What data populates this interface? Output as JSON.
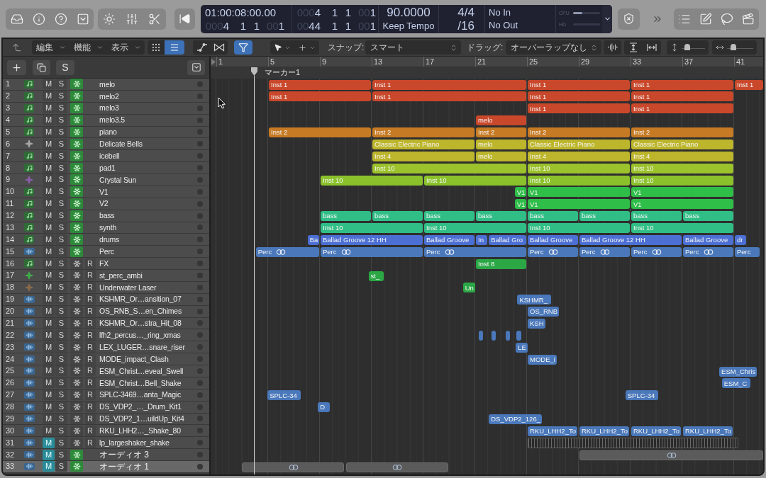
{
  "control_bar": {
    "lcd": {
      "smpte": "01:00:08:00.00",
      "position": [
        {
          "lead": "000",
          "digits": "4"
        },
        {
          "digits": "1"
        },
        {
          "digits": "1"
        },
        {
          "lead": "00",
          "digits": "1"
        }
      ],
      "left_locator": [
        {
          "lead": "000",
          "digits": "4"
        },
        {
          "digits": "1"
        },
        {
          "digits": "1"
        },
        {
          "lead": "00",
          "digits": "1"
        }
      ],
      "right_locator": [
        {
          "lead": "00",
          "digits": "44"
        },
        {
          "digits": "1"
        },
        {
          "digits": "1"
        },
        {
          "lead": "00",
          "digits": "1"
        }
      ],
      "tempo": "90.0000",
      "tempo_mode": "Keep Tempo",
      "time_signature": "4/4",
      "division": "/16",
      "midi_in": "No In",
      "midi_out": "No Out",
      "meters": [
        {
          "label": "CPU",
          "level": 0.35
        },
        {
          "label": "HD"
        }
      ]
    }
  },
  "arrange_toolbar": {
    "menus": [
      "編集",
      "機能",
      "表示"
    ],
    "view_toggles": [
      {
        "on": false
      },
      {
        "on": true
      },
      {
        "on": false
      },
      {
        "on": false
      },
      {
        "on": true
      }
    ],
    "snap_label": "スナップ:",
    "snap_value": "スマート",
    "drag_label": "ドラッグ:",
    "drag_value": "オーバーラップなし",
    "zoom_sliders": [
      {
        "level": 0.15
      },
      {
        "level": 0.18
      }
    ]
  },
  "track_list_header": {
    "solo_label": "S"
  },
  "ruler": {
    "bars": [
      "1",
      "5",
      "9",
      "13",
      "17",
      "21",
      "25",
      "29",
      "33",
      "37",
      "41"
    ],
    "marker": "マーカー1"
  },
  "tracks": [
    {
      "number": "1",
      "name": "melo",
      "icon": {
        "kind": "instrument"
      },
      "mute": {
        "label": "M",
        "on": false
      },
      "solo": {
        "label": "S",
        "on": false
      },
      "freeze": true,
      "selected": false,
      "color": "#c9482b",
      "regions": [
        {
          "label": "Inst 1",
          "kind": "plain"
        },
        {
          "label": "Inst 1",
          "kind": "plain"
        },
        {
          "label": "Inst 1",
          "kind": "plain"
        },
        {
          "label": "Inst 1",
          "kind": "plain"
        },
        {
          "label": "Inst 1",
          "kind": "plain"
        }
      ]
    },
    {
      "number": "2",
      "name": "melo2",
      "icon": {
        "kind": "instrument"
      },
      "mute": {
        "label": "M",
        "on": false
      },
      "solo": {
        "label": "S",
        "on": false
      },
      "freeze": true,
      "selected": false,
      "color": "#c9482b",
      "regions": [
        {
          "label": "Inst 1",
          "kind": "plain"
        },
        {
          "label": "Inst 1",
          "kind": "plain"
        },
        {
          "label": "Inst 1",
          "kind": "plain"
        },
        {
          "label": "Inst 1",
          "kind": "plain"
        }
      ]
    },
    {
      "number": "3",
      "name": "melo3",
      "icon": {
        "kind": "instrument"
      },
      "mute": {
        "label": "M",
        "on": false
      },
      "solo": {
        "label": "S",
        "on": false
      },
      "freeze": true,
      "selected": false,
      "color": "#c9482b",
      "regions": [
        {
          "label": "Inst 1",
          "kind": "plain"
        },
        {
          "label": "Inst 1",
          "kind": "plain"
        }
      ]
    },
    {
      "number": "4",
      "name": "melo3.5",
      "icon": {
        "kind": "instrument"
      },
      "mute": {
        "label": "M",
        "on": false
      },
      "solo": {
        "label": "S",
        "on": false
      },
      "freeze": true,
      "selected": false,
      "color": "#c9482b",
      "regions": [
        {
          "label": "melo",
          "kind": "plain"
        }
      ]
    },
    {
      "number": "5",
      "name": "piano",
      "icon": {
        "kind": "instrument"
      },
      "mute": {
        "label": "M",
        "on": false
      },
      "solo": {
        "label": "S",
        "on": false
      },
      "freeze": true,
      "selected": false,
      "color": "#c67a23",
      "regions": [
        {
          "label": "Inst 2",
          "kind": "plain"
        },
        {
          "label": "Inst 2",
          "kind": "plain"
        },
        {
          "label": "Inst 2",
          "kind": "plain"
        },
        {
          "label": "Inst 2",
          "kind": "plain"
        },
        {
          "label": "Inst 2",
          "kind": "plain"
        }
      ]
    },
    {
      "number": "6",
      "name": "Delicate Bells",
      "icon": {
        "kind": "patch",
        "color": "#a8a8a8"
      },
      "mute": {
        "label": "M",
        "on": false
      },
      "solo": {
        "label": "S",
        "on": false
      },
      "freeze": true,
      "selected": false,
      "color": "#bdb62c",
      "regions": [
        {
          "label": "Classic Electric Piano",
          "kind": "plain"
        },
        {
          "label": "melo",
          "kind": "plain"
        },
        {
          "label": "Classic Electric Piano",
          "kind": "plain"
        },
        {
          "label": "Classic Electric Piano",
          "kind": "plain"
        }
      ]
    },
    {
      "number": "7",
      "name": "icebell",
      "icon": {
        "kind": "instrument"
      },
      "mute": {
        "label": "M",
        "on": false
      },
      "solo": {
        "label": "S",
        "on": false
      },
      "freeze": true,
      "selected": false,
      "color": "#bdb62c",
      "regions": [
        {
          "label": "Inst 4",
          "kind": "plain"
        },
        {
          "label": "melo",
          "kind": "plain"
        },
        {
          "label": "Inst 4",
          "kind": "plain"
        },
        {
          "label": "Inst 4",
          "kind": "plain"
        }
      ]
    },
    {
      "number": "8",
      "name": "pad1",
      "icon": {
        "kind": "instrument"
      },
      "mute": {
        "label": "M",
        "on": false
      },
      "solo": {
        "label": "S",
        "on": false
      },
      "freeze": true,
      "selected": false,
      "color": "#9cc22c",
      "regions": [
        {
          "label": "Inst 10",
          "kind": "plain"
        },
        {
          "label": "Inst 10",
          "kind": "plain"
        },
        {
          "label": "Inst 10",
          "kind": "plain"
        }
      ]
    },
    {
      "number": "9",
      "name": "Crystal Sun",
      "icon": {
        "kind": "patch",
        "color": "#8b5fa8"
      },
      "mute": {
        "label": "M",
        "on": false
      },
      "solo": {
        "label": "S",
        "on": false
      },
      "freeze": true,
      "selected": false,
      "color": "#8bc22c",
      "regions": [
        {
          "label": "Inst 10",
          "kind": "plain"
        },
        {
          "label": "Inst 10",
          "kind": "plain"
        },
        {
          "label": "Inst 10",
          "kind": "plain"
        },
        {
          "label": "Inst 10",
          "kind": "plain"
        }
      ]
    },
    {
      "number": "10",
      "name": "V1",
      "icon": {
        "kind": "instrument"
      },
      "mute": {
        "label": "M",
        "on": false
      },
      "solo": {
        "label": "S",
        "on": false
      },
      "freeze": true,
      "selected": false,
      "color": "#2fbe48",
      "regions": [
        {
          "label": "V1",
          "kind": "plain"
        },
        {
          "label": "V1",
          "kind": "plain"
        },
        {
          "label": "V1",
          "kind": "plain"
        }
      ]
    },
    {
      "number": "11",
      "name": "V2",
      "icon": {
        "kind": "instrument"
      },
      "mute": {
        "label": "M",
        "on": false
      },
      "solo": {
        "label": "S",
        "on": false
      },
      "freeze": true,
      "selected": false,
      "color": "#2fbe48",
      "regions": [
        {
          "label": "V1",
          "kind": "plain"
        },
        {
          "label": "V1",
          "kind": "plain"
        },
        {
          "label": "V1",
          "kind": "plain"
        }
      ]
    },
    {
      "number": "12",
      "name": "bass",
      "icon": {
        "kind": "instrument"
      },
      "mute": {
        "label": "M",
        "on": false
      },
      "solo": {
        "label": "S",
        "on": false
      },
      "freeze": true,
      "selected": false,
      "color": "#30be86",
      "regions": [
        {
          "label": "bass",
          "kind": "plain"
        },
        {
          "label": "bass",
          "kind": "plain"
        },
        {
          "label": "bass",
          "kind": "plain"
        },
        {
          "label": "bass",
          "kind": "plain"
        },
        {
          "label": "bass",
          "kind": "plain"
        },
        {
          "label": "bass",
          "kind": "plain"
        },
        {
          "label": "bass",
          "kind": "plain"
        },
        {
          "label": "bass",
          "kind": "plain"
        }
      ]
    },
    {
      "number": "13",
      "name": "synth",
      "icon": {
        "kind": "instrument"
      },
      "mute": {
        "label": "M",
        "on": false
      },
      "solo": {
        "label": "S",
        "on": false
      },
      "freeze": true,
      "selected": false,
      "color": "#30be86",
      "regions": [
        {
          "label": "Inst 10",
          "kind": "plain"
        },
        {
          "label": "Inst 10",
          "kind": "plain"
        },
        {
          "label": "Inst 10",
          "kind": "plain"
        },
        {
          "label": "Inst 10",
          "kind": "plain"
        }
      ]
    },
    {
      "number": "14",
      "name": "drums",
      "icon": {
        "kind": "instrument"
      },
      "mute": {
        "label": "M",
        "on": false
      },
      "solo": {
        "label": "S",
        "on": false
      },
      "freeze": true,
      "selected": false,
      "color": "#4b6fd3",
      "regions": [
        {
          "label": "Ba",
          "kind": "plain"
        },
        {
          "label": "Ballad Groove 12 HH",
          "kind": "plain"
        },
        {
          "label": "Ballad Groove",
          "kind": "plain"
        },
        {
          "label": "In",
          "kind": "plain"
        },
        {
          "label": "Ballad Gro",
          "kind": "plain"
        },
        {
          "label": "Ballad Groove",
          "kind": "plain"
        },
        {
          "label": "Ballad Groove 12 HH",
          "kind": "plain"
        },
        {
          "label": "Ballad Groove",
          "kind": "plain"
        },
        {
          "label": "dr",
          "kind": "plain"
        }
      ]
    },
    {
      "number": "15",
      "name": "Perc",
      "icon": {
        "kind": "audio"
      },
      "mute": {
        "label": "M",
        "on": false
      },
      "solo": {
        "label": "S",
        "on": false
      },
      "freeze": true,
      "selected": false,
      "color": "#4a78ba",
      "regions": [
        {
          "label": "Perc",
          "kind": "linked"
        },
        {
          "label": "Perc",
          "kind": "linked"
        },
        {
          "label": "Perc",
          "kind": "linked"
        },
        {
          "label": "Perc",
          "kind": "linked"
        },
        {
          "label": "Perc",
          "kind": "linked"
        },
        {
          "label": "Perc",
          "kind": "linked"
        },
        {
          "label": "Perc",
          "kind": "linked"
        },
        {
          "label": "Perc",
          "kind": "plain"
        }
      ]
    },
    {
      "number": "16",
      "name": "FX",
      "icon": {
        "kind": "instrument"
      },
      "mute": {
        "label": "M",
        "on": false
      },
      "solo": {
        "label": "S",
        "on": false
      },
      "freeze": false,
      "record": {
        "label": "R",
        "on": false
      },
      "selected": false,
      "color": "#2ba845",
      "regions": [
        {
          "label": "Inst 8",
          "kind": "plain"
        }
      ]
    },
    {
      "number": "17",
      "name": "st_perc_ambi",
      "icon": {
        "kind": "patch",
        "color": "#3fae4a"
      },
      "mute": {
        "label": "M",
        "on": false
      },
      "solo": {
        "label": "S",
        "on": false
      },
      "freeze": false,
      "record": {
        "label": "R",
        "on": false
      },
      "selected": false,
      "color": "#2ba845",
      "regions": [
        {
          "label": "st_",
          "kind": "plain"
        }
      ]
    },
    {
      "number": "18",
      "name": "Underwater Laser",
      "icon": {
        "kind": "patch",
        "color": "#8c6a4c"
      },
      "mute": {
        "label": "M",
        "on": false
      },
      "solo": {
        "label": "S",
        "on": false
      },
      "freeze": false,
      "record": {
        "label": "R",
        "on": false
      },
      "selected": false,
      "color": "#2ba845",
      "regions": [
        {
          "label": "Un",
          "kind": "plain"
        }
      ]
    },
    {
      "number": "19",
      "name": "KSHMR_Or…ansition_07",
      "icon": {
        "kind": "audio"
      },
      "mute": {
        "label": "M",
        "on": false
      },
      "solo": {
        "label": "S",
        "on": false
      },
      "freeze": false,
      "record": {
        "label": "R",
        "on": false
      },
      "selected": false,
      "color": "#4a78ba",
      "regions": [
        {
          "label": "KSHMR_",
          "kind": "plain"
        }
      ]
    },
    {
      "number": "20",
      "name": "OS_RNB_S…en_Chimes",
      "icon": {
        "kind": "audio"
      },
      "mute": {
        "label": "M",
        "on": false
      },
      "solo": {
        "label": "S",
        "on": false
      },
      "freeze": false,
      "record": {
        "label": "R",
        "on": false
      },
      "selected": false,
      "color": "#4a78ba",
      "regions": [
        {
          "label": "OS_RNB",
          "kind": "plain"
        }
      ]
    },
    {
      "number": "21",
      "name": "KSHMR_Or…stra_Hit_08",
      "icon": {
        "kind": "audio"
      },
      "mute": {
        "label": "M",
        "on": false
      },
      "solo": {
        "label": "S",
        "on": false
      },
      "freeze": false,
      "record": {
        "label": "R",
        "on": false
      },
      "selected": false,
      "color": "#4a78ba",
      "regions": [
        {
          "label": "KSH",
          "kind": "plain"
        }
      ]
    },
    {
      "number": "22",
      "name": "lfh2_percus…_ring_xmas",
      "icon": {
        "kind": "audio"
      },
      "mute": {
        "label": "M",
        "on": false
      },
      "solo": {
        "label": "S",
        "on": false
      },
      "freeze": false,
      "record": {
        "label": "R",
        "on": false
      },
      "selected": false,
      "color": "#4a78ba",
      "regions": [
        {
          "kind": "plain"
        },
        {
          "kind": "plain"
        },
        {
          "kind": "plain"
        },
        {
          "kind": "plain"
        }
      ]
    },
    {
      "number": "23",
      "name": "LEX_LUGER…snare_riser",
      "icon": {
        "kind": "audio"
      },
      "mute": {
        "label": "M",
        "on": false
      },
      "solo": {
        "label": "S",
        "on": false
      },
      "freeze": false,
      "record": {
        "label": "R",
        "on": false
      },
      "selected": false,
      "color": "#4a78ba",
      "regions": [
        {
          "label": "LE",
          "kind": "plain"
        }
      ]
    },
    {
      "number": "24",
      "name": "MODE_impact_Clash",
      "icon": {
        "kind": "audio"
      },
      "mute": {
        "label": "M",
        "on": false
      },
      "solo": {
        "label": "S",
        "on": false
      },
      "freeze": false,
      "record": {
        "label": "R",
        "on": false
      },
      "selected": false,
      "color": "#4a78ba",
      "regions": [
        {
          "label": "MODE_i",
          "kind": "plain"
        }
      ]
    },
    {
      "number": "25",
      "name": "ESM_Christ…eveal_Swell",
      "icon": {
        "kind": "audio"
      },
      "mute": {
        "label": "M",
        "on": false
      },
      "solo": {
        "label": "S",
        "on": false
      },
      "freeze": false,
      "record": {
        "label": "R",
        "on": false
      },
      "selected": false,
      "color": "#4a78ba",
      "regions": [
        {
          "label": "ESM_Chris",
          "kind": "plain"
        }
      ]
    },
    {
      "number": "26",
      "name": "ESM_Christ…Bell_Shake",
      "icon": {
        "kind": "audio"
      },
      "mute": {
        "label": "M",
        "on": false
      },
      "solo": {
        "label": "S",
        "on": false
      },
      "freeze": false,
      "record": {
        "label": "R",
        "on": false
      },
      "selected": false,
      "color": "#4a78ba",
      "regions": [
        {
          "label": "ESM_C",
          "kind": "plain"
        }
      ]
    },
    {
      "number": "27",
      "name": "SPLC-3469…anta_Magic",
      "icon": {
        "kind": "audio"
      },
      "mute": {
        "label": "M",
        "on": false
      },
      "solo": {
        "label": "S",
        "on": false
      },
      "freeze": false,
      "record": {
        "label": "R",
        "on": false
      },
      "selected": false,
      "color": "#4a78ba",
      "regions": [
        {
          "label": "SPLC-34",
          "kind": "plain"
        },
        {
          "label": "SPLC-34",
          "kind": "plain"
        }
      ]
    },
    {
      "number": "28",
      "name": "DS_VDP2_…_Drum_Kit1",
      "icon": {
        "kind": "audio"
      },
      "mute": {
        "label": "M",
        "on": false
      },
      "solo": {
        "label": "S",
        "on": false
      },
      "freeze": false,
      "record": {
        "label": "R",
        "on": false
      },
      "selected": false,
      "color": "#4a78ba",
      "regions": [
        {
          "label": "D",
          "kind": "plain"
        }
      ]
    },
    {
      "number": "29",
      "name": "DS_VDP2_1…uildUp_Kit4",
      "icon": {
        "kind": "audio"
      },
      "mute": {
        "label": "M",
        "on": false
      },
      "solo": {
        "label": "S",
        "on": false
      },
      "freeze": false,
      "record": {
        "label": "R",
        "on": false
      },
      "selected": false,
      "color": "#4a78ba",
      "regions": [
        {
          "label": "DS_VDP2_126_",
          "kind": "plain"
        }
      ]
    },
    {
      "number": "30",
      "name": "RKU_LHH2…_Shake_80",
      "icon": {
        "kind": "audio"
      },
      "mute": {
        "label": "M",
        "on": false
      },
      "solo": {
        "label": "S",
        "on": false
      },
      "freeze": false,
      "record": {
        "label": "R",
        "on": false
      },
      "selected": false,
      "color": "#4a78ba",
      "regions": [
        {
          "label": "RKU_LHH2_To",
          "kind": "plain"
        },
        {
          "label": "RKU_LHH2_To",
          "kind": "plain"
        },
        {
          "label": "RKU_LHH2_To",
          "kind": "plain"
        },
        {
          "label": "RKU_LHH2_To",
          "kind": "plain"
        }
      ]
    },
    {
      "number": "31",
      "name": "lp_largeshaker_shake",
      "icon": {
        "kind": "audio"
      },
      "mute": {
        "label": "M",
        "on": true
      },
      "solo": {
        "label": "S",
        "on": false
      },
      "freeze": false,
      "record": {
        "label": "R",
        "on": false
      },
      "selected": false,
      "regions": [
        {
          "kind": "waveform"
        }
      ]
    },
    {
      "number": "32",
      "name": "オーディオ 3",
      "icon": {
        "kind": "audio"
      },
      "mute": {
        "label": "M",
        "on": true
      },
      "solo": {
        "label": "S",
        "on": false
      },
      "freeze": true,
      "selected": false,
      "regions": [
        {
          "kind": "linked"
        }
      ]
    },
    {
      "number": "33",
      "name": "オーディオ 1",
      "icon": {
        "kind": "audio"
      },
      "mute": {
        "label": "M",
        "on": true
      },
      "solo": {
        "label": "S",
        "on": false
      },
      "freeze": true,
      "selected": true,
      "regions": [
        {
          "kind": "linked"
        },
        {
          "kind": "linked"
        }
      ]
    }
  ]
}
